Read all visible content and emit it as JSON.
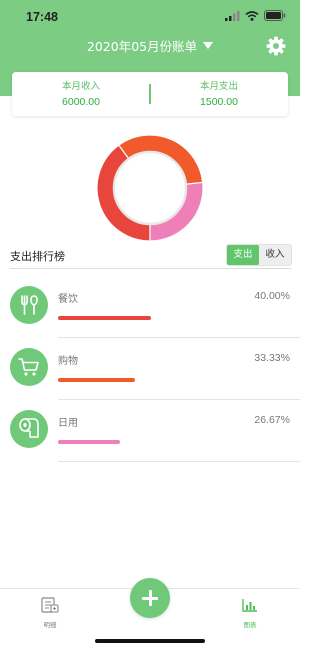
{
  "status_bar": {
    "time": "17:48"
  },
  "header": {
    "title": "2020年05月份账单",
    "bg_color": "#7ccc84"
  },
  "summary": {
    "income_label": "本月收入",
    "income_value": "6000.00",
    "expense_label": "本月支出",
    "expense_value": "1500.00"
  },
  "chart_data": {
    "type": "pie",
    "donut": true,
    "slices": [
      {
        "label": "餐饮",
        "value": 40.0,
        "color": "#e8453c"
      },
      {
        "label": "购物",
        "value": 33.33,
        "color": "#f15a2b"
      },
      {
        "label": "日用",
        "value": 26.67,
        "color": "#ee7fb9"
      }
    ]
  },
  "ranking": {
    "title": "支出排行榜",
    "toggle": {
      "expense_label": "支出",
      "income_label": "收入",
      "active": "expense"
    },
    "items": [
      {
        "name": "餐饮",
        "percent": "40.00%",
        "icon": "utensils-icon",
        "bar_color": "#e8453c",
        "fill": 0.4
      },
      {
        "name": "购物",
        "percent": "33.33%",
        "icon": "shopping-cart-icon",
        "bar_color": "#f15a2b",
        "fill": 0.3333
      },
      {
        "name": "日用",
        "percent": "26.67%",
        "icon": "toilet-paper-icon",
        "bar_color": "#ee7fb9",
        "fill": 0.2667
      }
    ]
  },
  "tabbar": {
    "details_label": "明细",
    "chart_label": "图表",
    "active_tab": "chart",
    "active_color": "#4cbd58"
  }
}
